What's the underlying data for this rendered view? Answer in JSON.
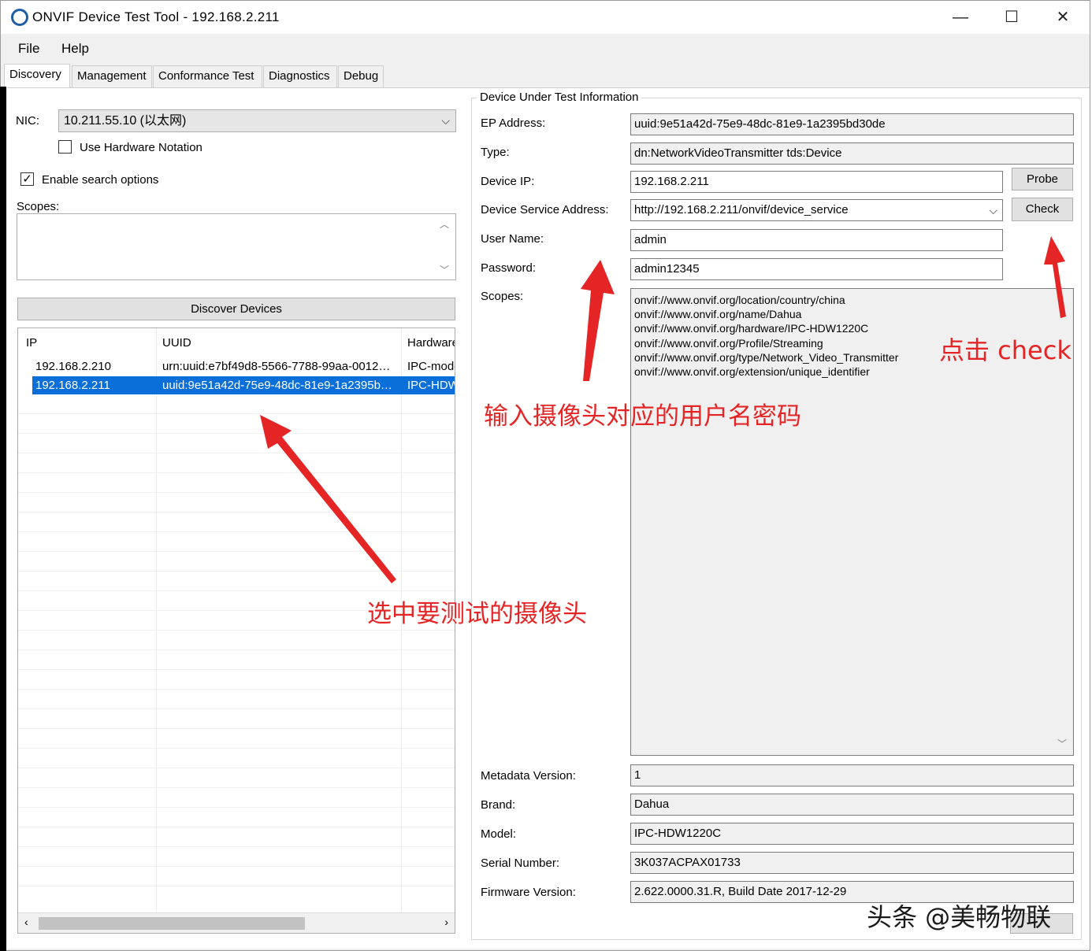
{
  "window": {
    "title": "ONVIF Device Test Tool - 192.168.2.211",
    "controls": {
      "minimize": "—",
      "maximize": "☐",
      "close": "✕"
    }
  },
  "menu": {
    "file": "File",
    "help": "Help"
  },
  "tabs": [
    "Discovery",
    "Management",
    "Conformance Test",
    "Diagnostics",
    "Debug"
  ],
  "discovery": {
    "nic_label": "NIC:",
    "nic_value": "10.211.55.10 (以太网)",
    "use_hw_notation": "Use Hardware Notation",
    "use_hw_checked": false,
    "enable_search": "Enable search options",
    "enable_search_checked": true,
    "scopes_label": "Scopes:",
    "discover_button": "Discover Devices",
    "columns": [
      "IP",
      "UUID",
      "Hardware"
    ],
    "devices": [
      {
        "ip": "192.168.2.210",
        "uuid": "urn:uuid:e7bf49d8-5566-7788-99aa-0012…",
        "hardware": "IPC-mode"
      },
      {
        "ip": "192.168.2.211",
        "uuid": "uuid:9e51a42d-75e9-48dc-81e9-1a2395b…",
        "hardware": "IPC-HDW"
      }
    ],
    "selected_index": 1
  },
  "dut": {
    "group_title": "Device Under Test Information",
    "ep_label": "EP Address:",
    "ep_value": "uuid:9e51a42d-75e9-48dc-81e9-1a2395bd30de",
    "type_label": "Type:",
    "type_value": "dn:NetworkVideoTransmitter tds:Device",
    "ip_label": "Device IP:",
    "ip_value": "192.168.2.211",
    "probe_button": "Probe",
    "service_label": "Device Service Address:",
    "service_value": "http://192.168.2.211/onvif/device_service",
    "check_button": "Check",
    "user_label": "User Name:",
    "user_value": "admin",
    "password_label": "Password:",
    "password_value": "admin12345",
    "scopes_label": "Scopes:",
    "scopes": [
      "onvif://www.onvif.org/location/country/china",
      "onvif://www.onvif.org/name/Dahua",
      "onvif://www.onvif.org/hardware/IPC-HDW1220C",
      "onvif://www.onvif.org/Profile/Streaming",
      "onvif://www.onvif.org/type/Network_Video_Transmitter",
      "onvif://www.onvif.org/extension/unique_identifier"
    ],
    "metadata_label": "Metadata Version:",
    "metadata_value": "1",
    "brand_label": "Brand:",
    "brand_value": "Dahua",
    "model_label": "Model:",
    "model_value": "IPC-HDW1220C",
    "serial_label": "Serial Number:",
    "serial_value": "3K037ACPAX01733",
    "firmware_label": "Firmware Version:",
    "firmware_value": "2.622.0000.31.R, Build Date 2017-12-29"
  },
  "annotations": {
    "click_check": "点击 check",
    "enter_credentials": "输入摄像头对应的用户名密码",
    "select_camera": "选中要测试的摄像头",
    "color": "#e52525"
  },
  "watermark": "头条 @美畅物联"
}
